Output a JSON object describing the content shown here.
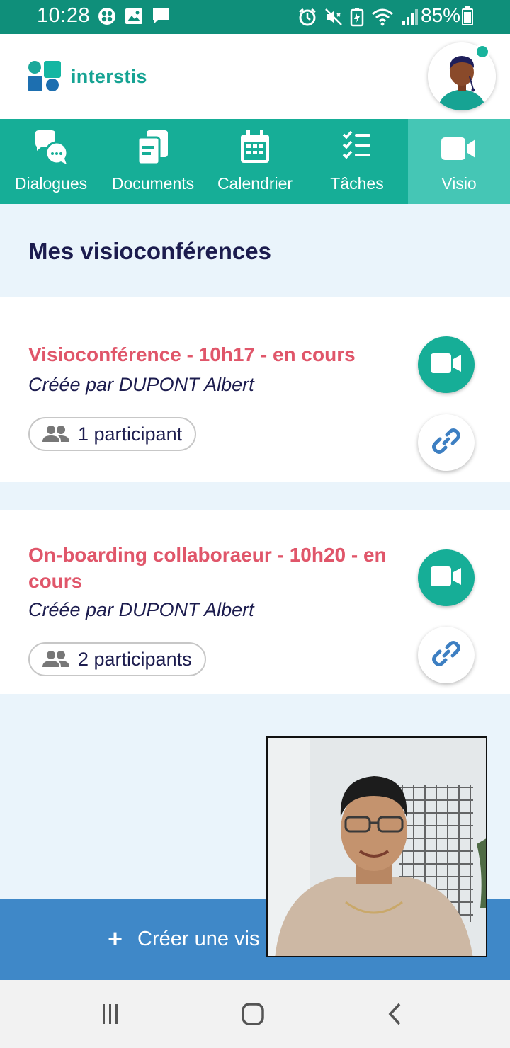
{
  "status_bar": {
    "time": "10:28",
    "battery": "85%",
    "icons_left": [
      "photos-icon",
      "gallery-icon",
      "message-icon"
    ],
    "icons_right": [
      "alarm-icon",
      "mute-icon",
      "battery-saver-icon",
      "wifi-icon",
      "signal-icon"
    ]
  },
  "header": {
    "brand": "interstis",
    "brand_color": "#16a393",
    "online_status_color": "#18b39c"
  },
  "tabs": [
    {
      "label": "Dialogues",
      "icon": "chat-bubbles-icon",
      "active": false
    },
    {
      "label": "Documents",
      "icon": "documents-icon",
      "active": false
    },
    {
      "label": "Calendrier",
      "icon": "calendar-icon",
      "active": false
    },
    {
      "label": "Tâches",
      "icon": "checklist-icon",
      "active": false
    },
    {
      "label": "Visio",
      "icon": "video-camera-icon",
      "active": true
    }
  ],
  "page": {
    "title": "Mes visioconférences"
  },
  "meetings": [
    {
      "title": "Visioconférence - 10h17 - en cours",
      "creator": "Créée par DUPONT Albert",
      "participants": "1 participant"
    },
    {
      "title": "On-boarding collaboraeur - 10h20 - en cours",
      "creator": "Créée par DUPONT Albert",
      "participants": "2 participants"
    }
  ],
  "create_button": {
    "plus": "+",
    "label": "Créer une vis"
  },
  "colors": {
    "accent_teal": "#16ae97",
    "active_tab": "#45c6b5",
    "meeting_title": "#e0566a",
    "create_bar": "#3f88c8",
    "link_icon": "#3d7fc2"
  }
}
